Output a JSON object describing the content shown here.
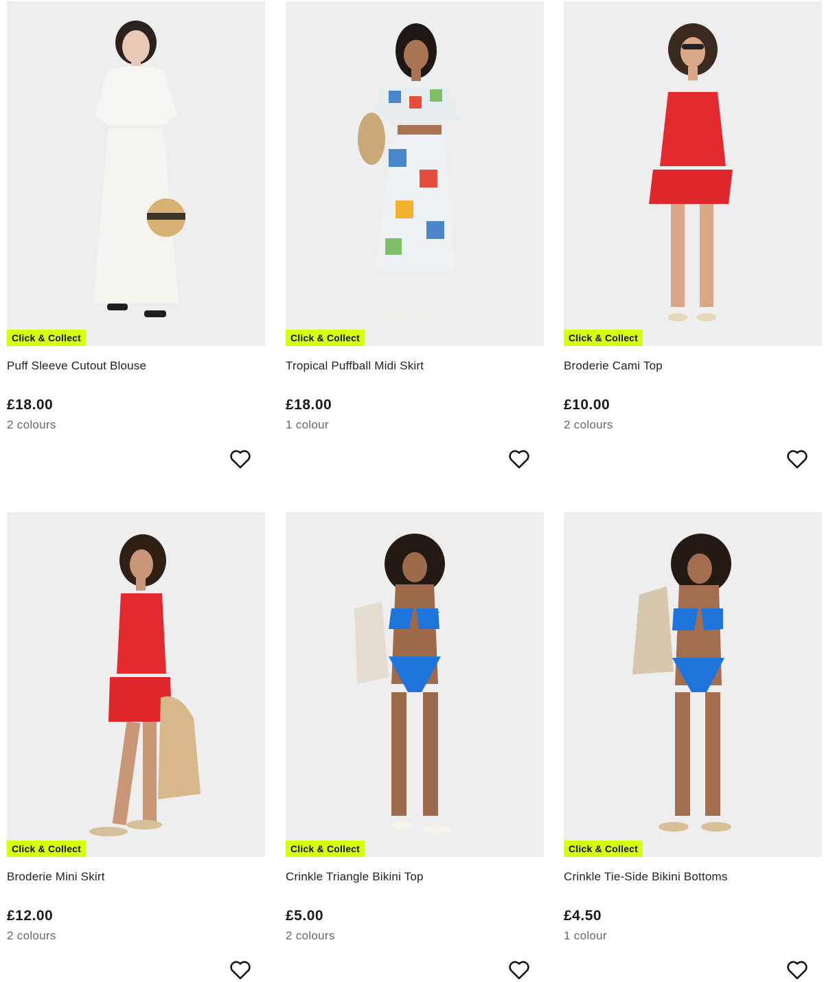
{
  "products": [
    {
      "name": "Puff Sleeve Cutout Blouse",
      "price": "£18.00",
      "colours": "2 colours",
      "badge": "Click & Collect",
      "image": "white-puff-sleeve-outfit"
    },
    {
      "name": "Tropical Puffball Midi Skirt",
      "price": "£18.00",
      "colours": "1 colour",
      "badge": "Click & Collect",
      "image": "tropical-print-skirt-outfit"
    },
    {
      "name": "Broderie Cami Top",
      "price": "£10.00",
      "colours": "2 colours",
      "badge": "Click & Collect",
      "image": "red-broderie-cami-outfit"
    },
    {
      "name": "Broderie Mini Skirt",
      "price": "£12.00",
      "colours": "2 colours",
      "badge": "Click & Collect",
      "image": "red-broderie-mini-skirt-outfit"
    },
    {
      "name": "Crinkle Triangle Bikini Top",
      "price": "£5.00",
      "colours": "2 colours",
      "badge": "Click & Collect",
      "image": "blue-bikini-outfit"
    },
    {
      "name": "Crinkle Tie-Side Bikini Bottoms",
      "price": "£4.50",
      "colours": "1 colour",
      "badge": "Click & Collect",
      "image": "blue-bikini-bottoms-outfit"
    }
  ],
  "icons": {
    "favourite": "heart-outline-icon"
  },
  "colors": {
    "badge_bg": "#d6ff0f",
    "image_bg": "#eeeeef",
    "text": "#222222",
    "muted": "#666666"
  }
}
